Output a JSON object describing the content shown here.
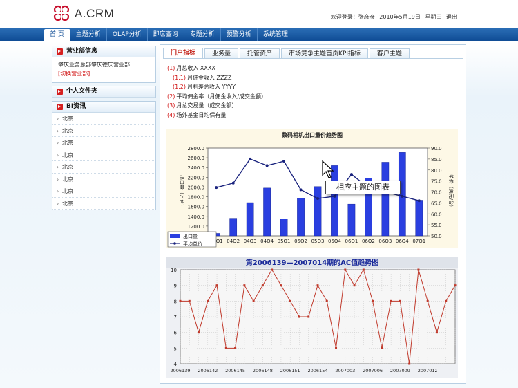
{
  "header": {
    "logo_text": "A.CRM",
    "welcome": "欢迎登录！张彦彦",
    "date": "2010年5月19日",
    "weekday": "星期三",
    "logout": "退出",
    "brand_color": "#c8102e"
  },
  "nav": {
    "items": [
      {
        "label": "首 页",
        "active": true
      },
      {
        "label": "主题分析"
      },
      {
        "label": "OLAP分析"
      },
      {
        "label": "即席查询"
      },
      {
        "label": "专题分析"
      },
      {
        "label": "预警分析"
      },
      {
        "label": "系统管理"
      }
    ],
    "color": "#0f4c95"
  },
  "sidebar": {
    "dept": {
      "title": "营业部信息",
      "name": "肇庆业务总部肇庆德庆营业部",
      "switch_link": "[切换营业部]"
    },
    "files": {
      "title": "个人文件夹"
    },
    "bi": {
      "title": "BI资讯",
      "items": [
        "北京",
        "北京",
        "北京",
        "北京",
        "北京",
        "北京",
        "北京",
        "北京"
      ]
    }
  },
  "tabs": [
    "门户指标",
    "业务量",
    "托管资产",
    "市场竞争主题首页KPI指标",
    "客户主题"
  ],
  "indicators": [
    {
      "num": "(1)",
      "label": "月总收入 XXXX",
      "level": 1
    },
    {
      "num": "(1.1)",
      "label": "月佣金收入 ZZZZ",
      "level": 2
    },
    {
      "num": "(1.2)",
      "label": "月利差总收入 YYYY",
      "level": 2
    },
    {
      "num": "(2)",
      "label": "平均佣金率（月佣金收入/成交金额）",
      "level": 1
    },
    {
      "num": "(3)",
      "label": "月总交易量（成交金额）",
      "level": 1
    },
    {
      "num": "(4)",
      "label": "场外基金日均保有量",
      "level": 1
    }
  ],
  "tooltip": "相应主题的图表",
  "chart_data": [
    {
      "type": "bar",
      "title": "数码相机出口量价趋势图",
      "categories": [
        "04Q1",
        "04Q2",
        "04Q3",
        "04Q4",
        "05Q1",
        "05Q2",
        "05Q3",
        "05Q4",
        "06Q1",
        "06Q2",
        "06Q3",
        "06Q4",
        "07Q1"
      ],
      "series": [
        {
          "name": "出口量",
          "kind": "bar",
          "axis": "left",
          "color": "#2a3fe0",
          "values": [
            1050,
            1360,
            1680,
            1980,
            1350,
            1770,
            2010,
            2440,
            1650,
            2180,
            2510,
            2710,
            1730
          ]
        },
        {
          "name": "平均单价",
          "kind": "line",
          "axis": "right",
          "color": "#1a237e",
          "values": [
            72,
            74,
            85,
            82,
            84,
            71,
            67,
            68,
            78,
            72,
            70,
            68,
            66
          ]
        }
      ],
      "ylabel": "出口量（万台）",
      "y2label": "单价（美元/台）",
      "ylim": [
        1000,
        2800
      ],
      "y2lim": [
        50,
        90
      ],
      "yticks": [
        "2800.0",
        "2600.0",
        "2400.0",
        "2200.0",
        "2000.0",
        "1800.0",
        "1600.0",
        "1400.0",
        "1200.0",
        "1000.0"
      ],
      "y2ticks": [
        "90.0",
        "85.0",
        "80.0",
        "75.0",
        "70.0",
        "65.0",
        "60.0",
        "55.0",
        "50.0"
      ],
      "legend_position": "bottom-left"
    },
    {
      "type": "line",
      "title": "第2006139—2007014期的AC值趋势图",
      "x_ticks": [
        "2006139",
        "2006142",
        "2006145",
        "2006148",
        "2006151",
        "2006154",
        "2007003",
        "2007006",
        "2007009",
        "2007012"
      ],
      "values": [
        8,
        8,
        6,
        8,
        9,
        5,
        5,
        9,
        8,
        9,
        10,
        9,
        8,
        7,
        7,
        9,
        8,
        5,
        10,
        9,
        10,
        8,
        5,
        8,
        8,
        4,
        10,
        8,
        6,
        8,
        9
      ],
      "ylim": [
        4,
        10
      ],
      "yticks": [
        "10",
        "9",
        "8",
        "7",
        "6",
        "5",
        "4"
      ],
      "grid": true,
      "color": "#c0392b"
    }
  ]
}
